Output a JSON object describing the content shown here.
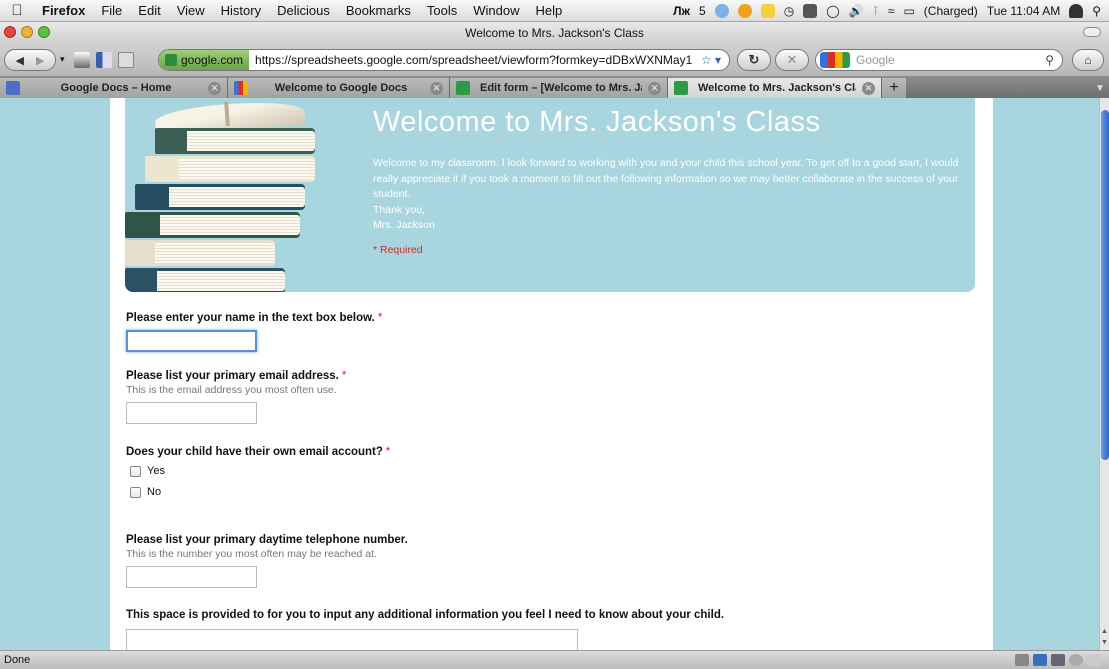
{
  "menubar": {
    "app_name": "Firefox",
    "items": [
      "File",
      "Edit",
      "View",
      "History",
      "Delicious",
      "Bookmarks",
      "Tools",
      "Window",
      "Help"
    ],
    "status_num": "5",
    "battery_text": "(Charged)",
    "clock": "Tue 11:04 AM"
  },
  "window": {
    "title": "Welcome to Mrs. Jackson's Class"
  },
  "navbar": {
    "domain": "google.com",
    "url": "https://spreadsheets.google.com/spreadsheet/viewform?formkey=dDBxWXNMay1",
    "search_placeholder": "Google"
  },
  "tabs": [
    {
      "label": "Google Docs – Home",
      "favicon_color": "#4a6fc4"
    },
    {
      "label": "Welcome to Google Docs",
      "favicon_color": "#3b6fd8"
    },
    {
      "label": "Edit form – [Welcome to Mrs. Ja...",
      "favicon_color": "#2e9a44"
    },
    {
      "label": "Welcome to Mrs. Jackson's Class",
      "favicon_color": "#2e9a44",
      "active": true
    }
  ],
  "form": {
    "title": "Welcome to Mrs. Jackson's Class",
    "description": [
      "Welcome to my classroom. I look forward to working with you and your child this school year. To get off to a good start, I would really appreciate it if you took a moment to fill out the following information so we may better collaborate in the success of your student.",
      "Thank you,",
      "Mrs. Jackson"
    ],
    "required_note": "* Required",
    "questions": {
      "name": {
        "label": "Please enter your name in the text box below.",
        "required_mark": "*",
        "value": ""
      },
      "email": {
        "label": "Please list your primary email address.",
        "required_mark": "*",
        "help": "This is the email address you most often use.",
        "value": ""
      },
      "child_email": {
        "label": "Does your child have their own email account?",
        "required_mark": "*",
        "options": [
          "Yes",
          "No"
        ]
      },
      "phone": {
        "label": "Please list your primary daytime telephone number.",
        "help": "This is the number you most often may be reached at.",
        "value": ""
      },
      "additional": {
        "label": "This space is provided to for you to input any additional information you feel I need to know about your child.",
        "value": ""
      }
    }
  },
  "statusbar": {
    "text": "Done"
  },
  "colors": {
    "page_bg": "#a9d5df",
    "required_red": "#c4302b",
    "focus_blue": "#5d8fd3"
  }
}
